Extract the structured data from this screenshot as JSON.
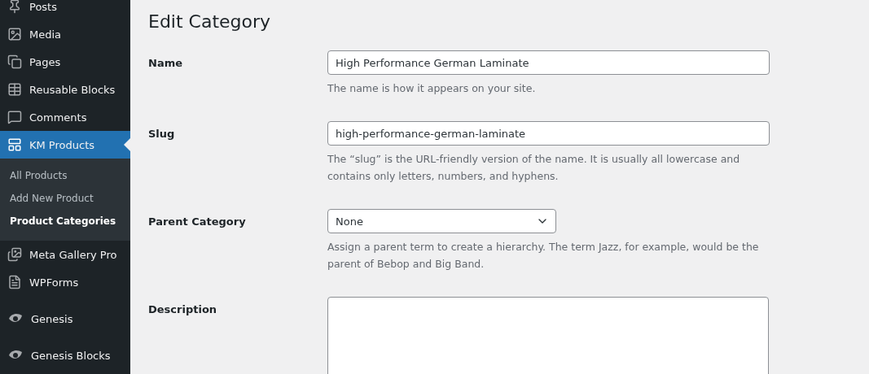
{
  "sidebar": {
    "items": [
      {
        "label": "Posts",
        "selected": false
      },
      {
        "label": "Media",
        "selected": false
      },
      {
        "label": "Pages",
        "selected": false
      },
      {
        "label": "Reusable Blocks",
        "selected": false
      },
      {
        "label": "Comments",
        "selected": false
      },
      {
        "label": "KM Products",
        "selected": true,
        "children": [
          {
            "label": "All Products",
            "selected": false
          },
          {
            "label": "Add New Product",
            "selected": false
          },
          {
            "label": "Product Categories",
            "selected": true
          }
        ]
      },
      {
        "label": "Meta Gallery Pro",
        "selected": false
      },
      {
        "label": "WPForms",
        "selected": false
      },
      {
        "label": "Genesis",
        "selected": false
      },
      {
        "label": "Genesis Blocks",
        "selected": false
      }
    ]
  },
  "page": {
    "title": "Edit Category",
    "fields": [
      {
        "kind": "text",
        "label": "Name",
        "value": "High Performance German Laminate",
        "help": "The name is how it appears on your site."
      },
      {
        "kind": "text",
        "label": "Slug",
        "value": "high-performance-german-laminate",
        "help": "The “slug” is the URL-friendly version of the name. It is usually all lowercase and contains only letters, numbers, and hyphens."
      },
      {
        "kind": "select",
        "label": "Parent Category",
        "value": "None",
        "help": "Assign a parent term to create a hierarchy. The term Jazz, for example, would be the parent of Bebop and Big Band."
      },
      {
        "kind": "textarea",
        "label": "Description"
      }
    ]
  }
}
